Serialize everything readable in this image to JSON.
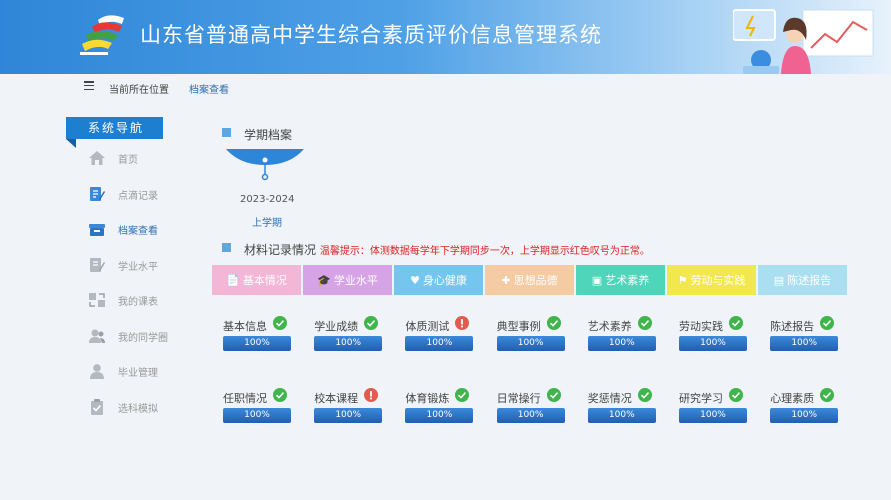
{
  "header": {
    "title": "山东省普通高中学生综合素质评价信息管理系统"
  },
  "breadcrumb": {
    "label": "当前所在位置",
    "current": "档案查看"
  },
  "sidebar": {
    "title": "系统导航",
    "items": [
      {
        "label": "首页",
        "icon": "home-icon"
      },
      {
        "label": "点滴记录",
        "icon": "edit-icon"
      },
      {
        "label": "档案查看",
        "icon": "archive-icon",
        "active": true
      },
      {
        "label": "学业水平",
        "icon": "document-edit-icon"
      },
      {
        "label": "我的课表",
        "icon": "swap-icon"
      },
      {
        "label": "我的同学圈",
        "icon": "users-icon"
      },
      {
        "label": "毕业管理",
        "icon": "user-icon"
      },
      {
        "label": "选科模拟",
        "icon": "clipboard-check-icon"
      }
    ]
  },
  "term_section": {
    "title": "学期档案",
    "year": "2023-2024",
    "semester": "上学期"
  },
  "records_section": {
    "title": "材料记录情况",
    "hint_label": "温馨提示：",
    "hint_text": "体测数据每学年下学期同步一次，上学期显示红色叹号为正常。"
  },
  "tabs": [
    {
      "label": "基本情况",
      "color": "#f3b6d6",
      "icon": "📄"
    },
    {
      "label": "学业水平",
      "color": "#d6a3e6",
      "icon": "🎓"
    },
    {
      "label": "身心健康",
      "color": "#75c6ef",
      "icon": "♥"
    },
    {
      "label": "思想品德",
      "color": "#f4cba3",
      "icon": "✚"
    },
    {
      "label": "艺术素养",
      "color": "#4fd5ba",
      "icon": "▣"
    },
    {
      "label": "劳动与实践",
      "color": "#f2e84d",
      "icon": "⚑"
    },
    {
      "label": "陈述报告",
      "color": "#a9dff0",
      "icon": "▤"
    }
  ],
  "items": [
    {
      "label": "基本信息",
      "status": "ok",
      "progress": "100%"
    },
    {
      "label": "学业成绩",
      "status": "ok",
      "progress": "100%"
    },
    {
      "label": "体质测试",
      "status": "warn",
      "progress": "100%"
    },
    {
      "label": "典型事例",
      "status": "ok",
      "progress": "100%"
    },
    {
      "label": "艺术素养",
      "status": "ok",
      "progress": "100%"
    },
    {
      "label": "劳动实践",
      "status": "ok",
      "progress": "100%"
    },
    {
      "label": "陈述报告",
      "status": "ok",
      "progress": "100%"
    },
    {
      "label": "任职情况",
      "status": "ok",
      "progress": "100%"
    },
    {
      "label": "校本课程",
      "status": "warn",
      "progress": "100%"
    },
    {
      "label": "体育锻炼",
      "status": "ok",
      "progress": "100%"
    },
    {
      "label": "日常操行",
      "status": "ok",
      "progress": "100%"
    },
    {
      "label": "奖惩情况",
      "status": "ok",
      "progress": "100%"
    },
    {
      "label": "研究学习",
      "status": "ok",
      "progress": "100%"
    },
    {
      "label": "心理素质",
      "status": "ok",
      "progress": "100%"
    }
  ]
}
